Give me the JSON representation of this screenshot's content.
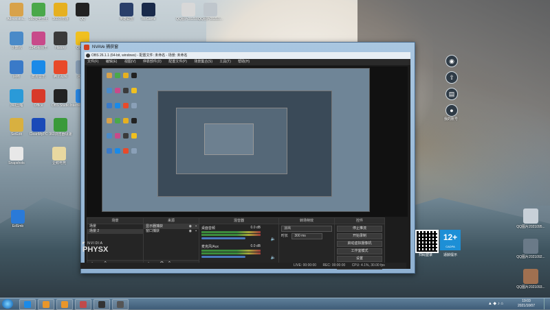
{
  "desktop": {
    "icons": [
      {
        "label": "Administra...",
        "color": "#d8a24a"
      },
      {
        "label": "360安全卫士",
        "color": "#4aa84a"
      },
      {
        "label": "360浏览器",
        "color": "#e6b020"
      },
      {
        "label": "QQ",
        "color": "#222222"
      },
      {
        "label": "英雄联盟",
        "color": "#2a3f6a"
      },
      {
        "label": "WeGame",
        "color": "#1a2a4a"
      },
      {
        "label": "计算机",
        "color": "#4a8ac8"
      },
      {
        "label": "2345看图王",
        "color": "#c84a8a"
      },
      {
        "label": "History",
        "color": "#3a3a3a"
      },
      {
        "label": "QQ音乐",
        "color": "#f0c020"
      },
      {
        "label": "网络",
        "color": "#3a7ac8"
      },
      {
        "label": "酷狗音乐",
        "color": "#1a8ae8"
      },
      {
        "label": "腾讯视频",
        "color": "#e84a2a"
      },
      {
        "label": "回收站",
        "color": "#8aa0b8"
      },
      {
        "label": "360压缩",
        "color": "#2a9ad8"
      },
      {
        "label": "Office",
        "color": "#d83a2a"
      },
      {
        "label": "OBS Studio",
        "color": "#222222"
      },
      {
        "label": "Internet Explorer",
        "color": "#2a8ae8"
      },
      {
        "label": "SetEdit",
        "color": "#d8b040"
      },
      {
        "label": "CleanMyPC",
        "color": "#1a4ab8"
      },
      {
        "label": "360浏览器极速",
        "color": "#3a9a3a"
      },
      {
        "label": "Snapshots",
        "color": "#e8e8e8"
      },
      {
        "label": "企鹅电竞",
        "color": "#e8d8a0"
      },
      {
        "label": "EdSmb",
        "color": "#2a7ad8"
      }
    ],
    "top_files": [
      {
        "label": "QQ图片20210..."
      },
      {
        "label": "QQ图片20210..."
      }
    ],
    "right_files": [
      {
        "label": "QQ图片2021095...",
        "color": "#c8d0d8"
      },
      {
        "label": "QQ图片2021092...",
        "color": "#6a7a88"
      },
      {
        "label": "QQ图片2021093...",
        "color": "#a07050"
      }
    ],
    "side_toolbar": [
      {
        "glyph": "◉",
        "label": "桌面"
      },
      {
        "glyph": "⇧",
        "label": "上传"
      },
      {
        "glyph": "▤",
        "label": "文档"
      },
      {
        "glyph": "●",
        "label": "我的账号"
      }
    ]
  },
  "window": {
    "title": "NVAVe 捕获窗",
    "obs_title": "OBS 26.1.1 (64-bit, windows) - 配置文件: 未命名 - 场景: 未命名",
    "menu": [
      "文件(F)",
      "编辑(E)",
      "视图(V)",
      "停靠部件(D)",
      "配置文件(P)",
      "场景集合(S)",
      "工具(T)",
      "帮助(H)"
    ],
    "docks": {
      "scenes": {
        "title": "场景",
        "items": [
          "场景",
          "场景 2"
        ]
      },
      "sources": {
        "title": "来源",
        "items": [
          "显示器捕获",
          "窗口捕获"
        ]
      },
      "mixer": {
        "title": "混音器",
        "channels": [
          {
            "name": "桌面音频",
            "level": "0.0 dB"
          },
          {
            "name": "麦克风/Aux",
            "level": "0.0 dB"
          }
        ]
      },
      "transitions": {
        "title": "转场特效",
        "mode": "淡出",
        "duration_label": "时长",
        "duration": "300 ms"
      },
      "controls": {
        "title": "控件",
        "buttons": [
          "停止推流",
          "开始录制",
          "启动虚拟摄像机",
          "工作室模式",
          "设置",
          "退出"
        ]
      }
    },
    "promo": {
      "qr_label": "扫码登录",
      "badge_text": "12+",
      "badge_sub": "CADPA",
      "badge_label": "适龄提示"
    },
    "nvidia_brand": "PHYSX",
    "status": {
      "live": "LIVE: 00:00:00",
      "rec": "REC: 00:00:00",
      "cpu": "CPU: 4.1%, 30.00 fps"
    }
  },
  "taskbar": {
    "time": "19:03",
    "date": "2021/10/07",
    "apps": [
      {
        "color": "#1a8ae8"
      },
      {
        "color": "#e8962a"
      },
      {
        "color": "#e8962a"
      },
      {
        "color": "#c04a4a"
      },
      {
        "color": "#333333"
      },
      {
        "color": "#555555"
      }
    ]
  }
}
